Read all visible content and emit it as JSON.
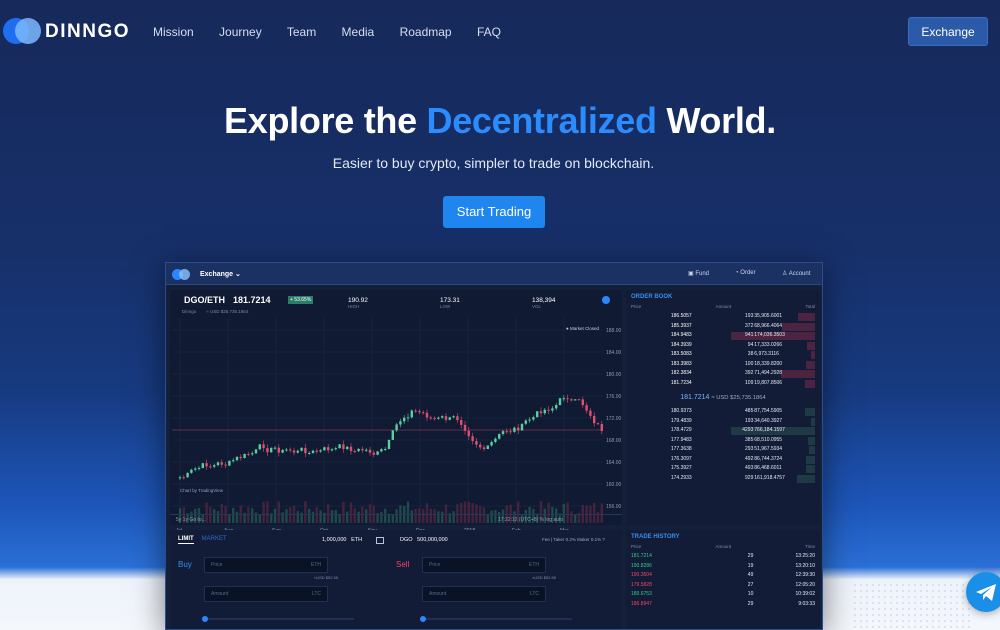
{
  "brand": {
    "name": "DINNGO"
  },
  "nav": {
    "items": [
      "Mission",
      "Journey",
      "Team",
      "Media",
      "Roadmap",
      "FAQ"
    ],
    "exchange": "Exchange"
  },
  "hero": {
    "title_pre": "Explore the",
    "title_highlight": "Decentralized",
    "title_post": "World.",
    "subtitle": "Easier to buy crypto, simpler to trade on blockchain.",
    "cta": "Start Trading"
  },
  "app": {
    "title": "Exchange",
    "fund": "Fund",
    "order": "Order",
    "account": "Account",
    "pair": "DGO/ETH",
    "price": "181.7214",
    "change": "+ 53.65%",
    "usd": "≈ USD $35,735.1864",
    "sub": "Dinngo",
    "high": "190.92",
    "high_l": "HIGH",
    "low": "173.31",
    "low_l": "LOW",
    "vol": "138,394",
    "vol_l": "VOL",
    "market_closed": "Market Closed",
    "tv": "Chart by TradingView",
    "y_ticks": [
      "188.00",
      "184.00",
      "180.00",
      "176.00",
      "172.00",
      "168.00",
      "164.00",
      "160.00",
      "156.00"
    ],
    "x_ticks": [
      "Jul",
      "Aug",
      "Sep",
      "Oct",
      "Nov",
      "Dec",
      "2018",
      "Feb",
      "Mar"
    ],
    "tools": "5y   1y   Go to...",
    "time": "17:22:12 (UTC+8)   %   log   auto",
    "orderbook": {
      "title": "ORDER BOOK",
      "h": [
        "Price",
        "Amount",
        "Total"
      ],
      "asks": [
        [
          "186.5057",
          "193",
          "35,905.6001"
        ],
        [
          "185.3937",
          "372",
          "68,966.4064"
        ],
        [
          "184.9483",
          "941",
          "174,036.3503"
        ],
        [
          "184.3939",
          "94",
          "17,333.0266"
        ],
        [
          "183.5083",
          "38",
          "6,973.3116"
        ],
        [
          "183.3983",
          "100",
          "18,339.8200"
        ],
        [
          "182.3834",
          "392",
          "71,494.2928"
        ],
        [
          "181.7234",
          "109",
          "19,807.8506"
        ]
      ],
      "mid": "181.7214",
      "mid_usd": "≈ USD $25,735.1864",
      "bids": [
        [
          "180.9373",
          "485",
          "87,754.5905"
        ],
        [
          "179.4839",
          "193",
          "34,640.3927"
        ],
        [
          "178.4729",
          "4293",
          "766,184.1597"
        ],
        [
          "177.9483",
          "385",
          "68,510.0955"
        ],
        [
          "177.3638",
          "293",
          "51,967.5934"
        ],
        [
          "176.3097",
          "492",
          "86,744.3724"
        ],
        [
          "175.3927",
          "493",
          "86,468.6011"
        ],
        [
          "174.2933",
          "929",
          "161,918.4757"
        ]
      ]
    },
    "form": {
      "limit": "LIMIT",
      "market": "MARKET",
      "eth_amt": "1,000,000",
      "eth": "ETH",
      "dgo": "DGO",
      "dgo_amt": "500,000,000",
      "fee": "Fee | Taker 0.2% Maker 0.1%  ?",
      "buy": "Buy",
      "sell": "Sell",
      "price": "Price",
      "amount": "Amount",
      "unit_eth": "ETH",
      "unit_ltc": "LTC",
      "usd_hint": "≈USD $52.55"
    },
    "history": {
      "title": "TRADE HISTORY",
      "h": [
        "Price",
        "Amount",
        "Time"
      ],
      "rows": [
        [
          "181.7214",
          "29",
          "13:25:20",
          "#38c98b"
        ],
        [
          "190.8286",
          "19",
          "13:20:10",
          "#38c98b"
        ],
        [
          "190.3504",
          "49",
          "12:39:30",
          "#f0466a"
        ],
        [
          "179.5828",
          "27",
          "12:05:20",
          "#f0466a"
        ],
        [
          "189.6753",
          "10",
          "10:39:02",
          "#38c98b"
        ],
        [
          "186.8947",
          "29",
          "9:03:33",
          "#f0466a"
        ]
      ]
    }
  },
  "colors": {
    "accent": "#2b8cff",
    "button": "#1f86f0",
    "up": "#38c98b",
    "down": "#f0466a"
  }
}
